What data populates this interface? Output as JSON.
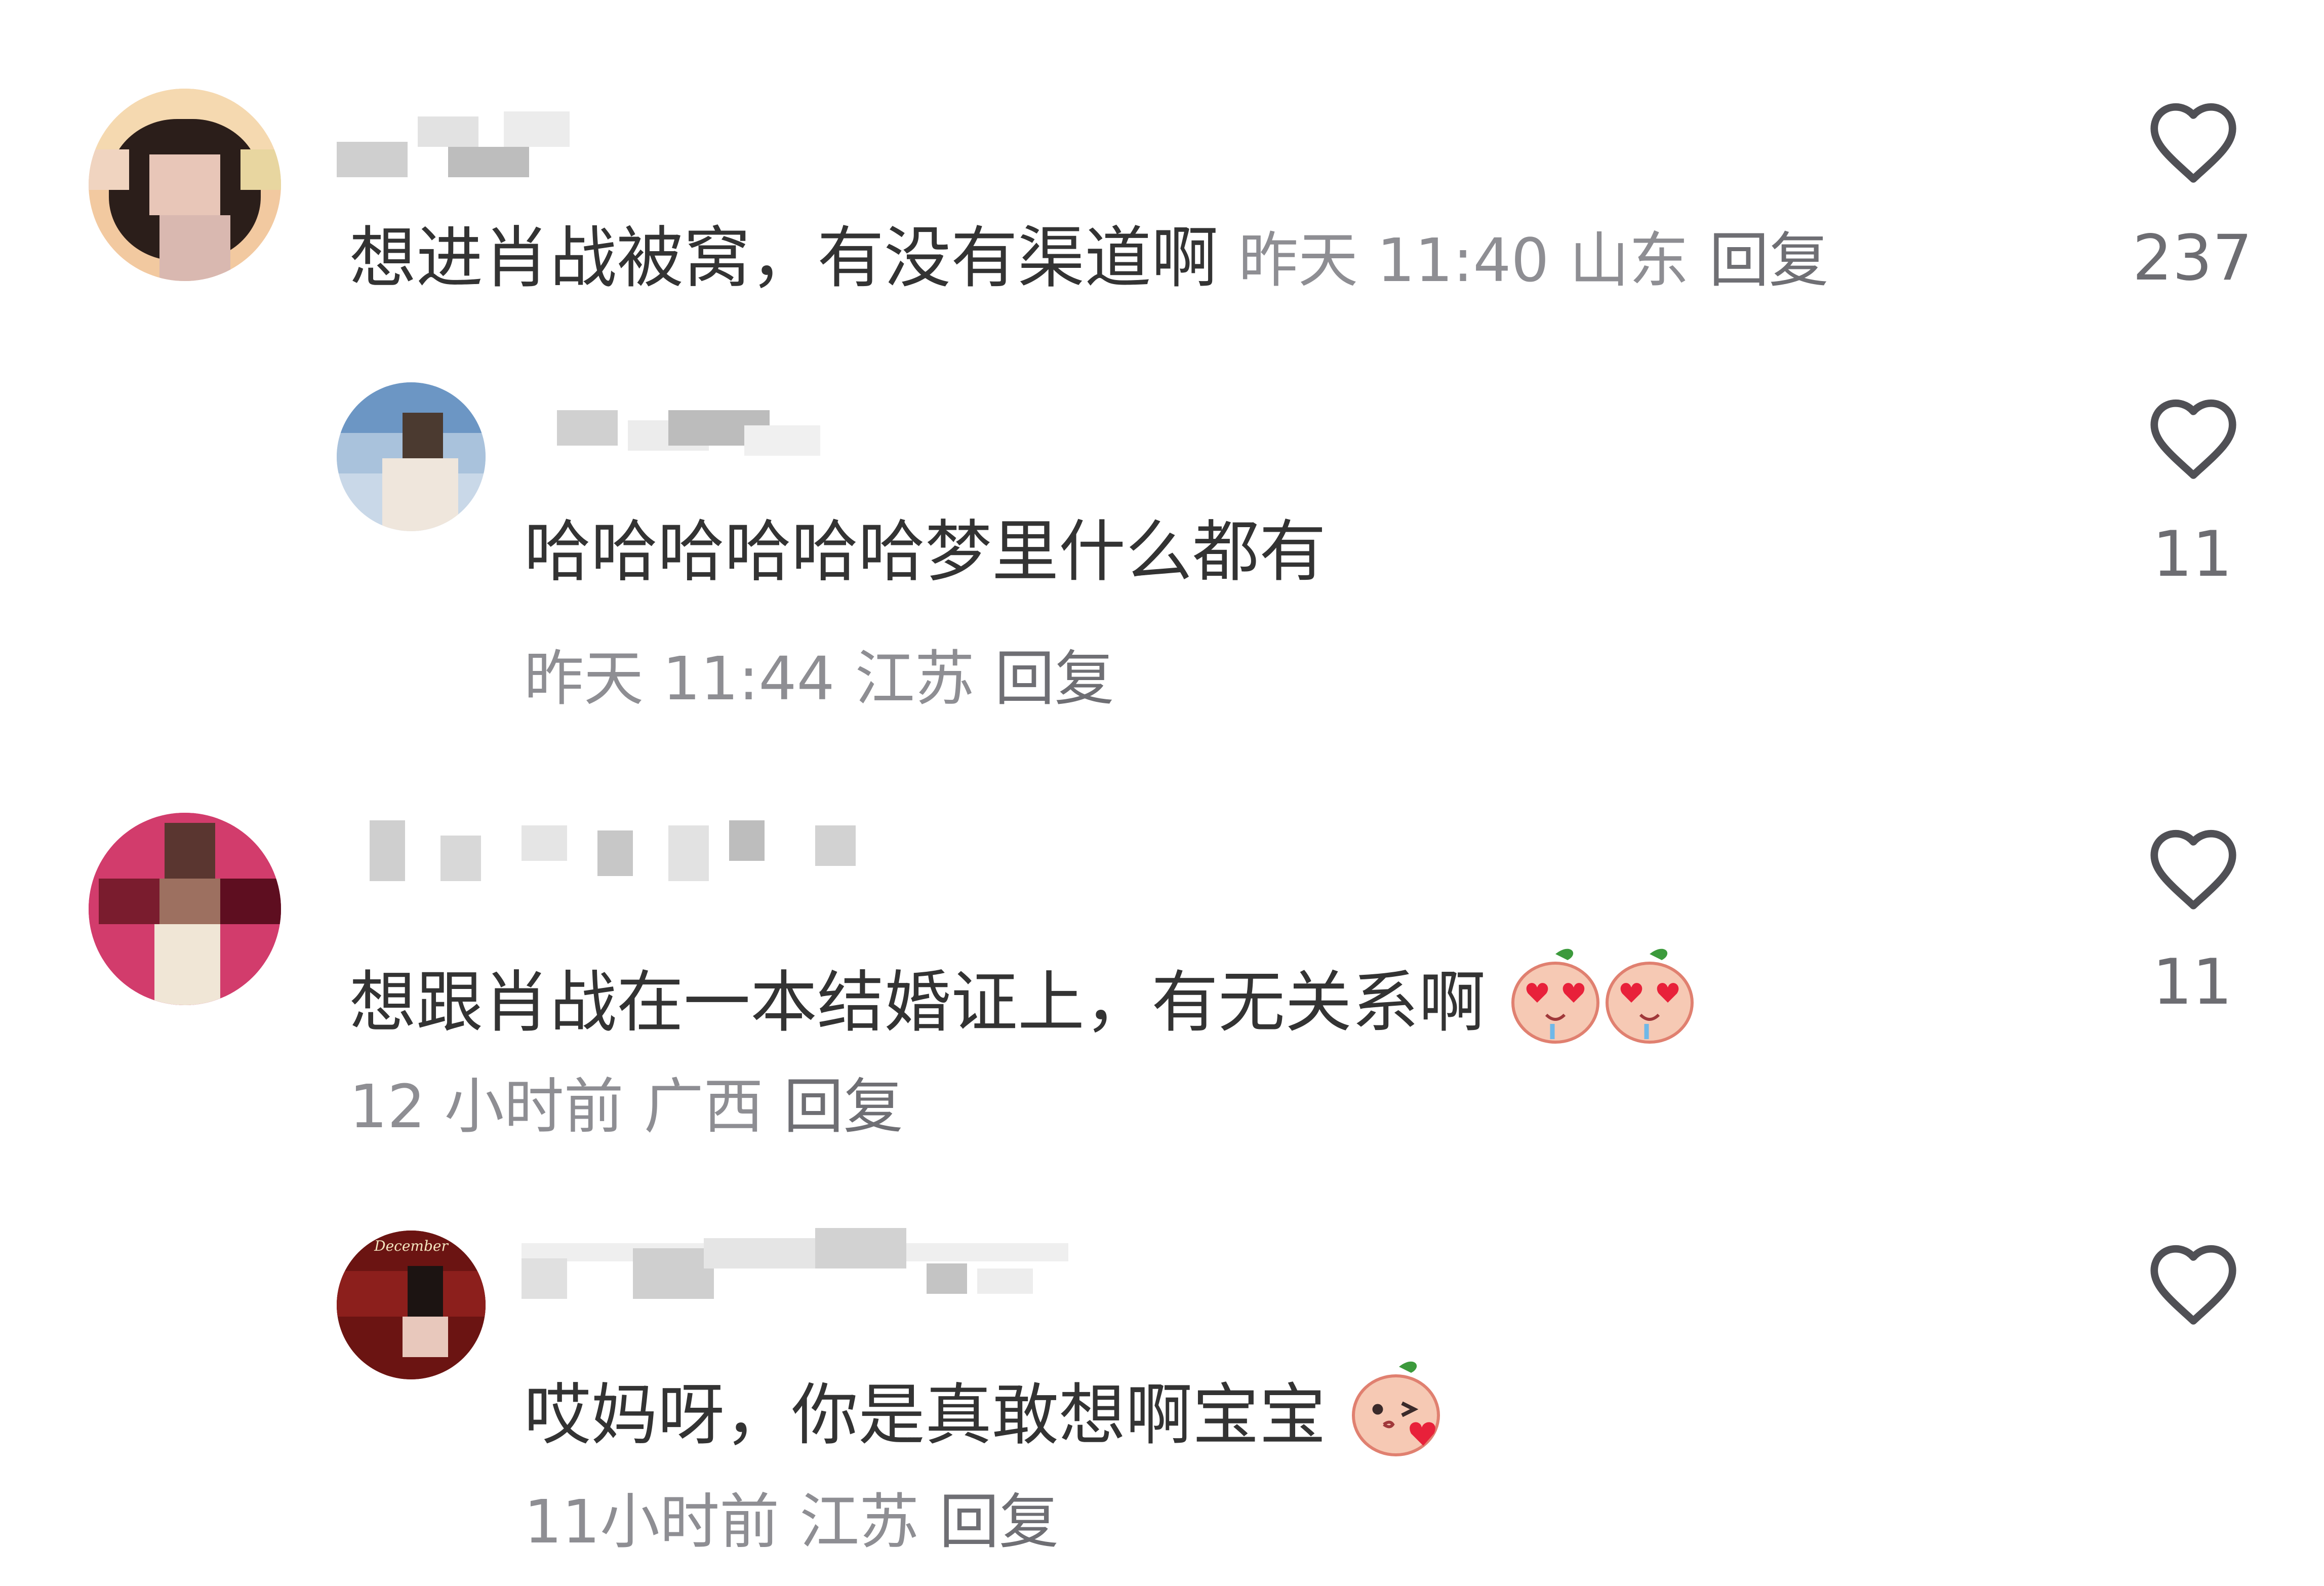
{
  "comments": [
    {
      "text": "想进肖战被窝，有没有渠道啊",
      "time": "昨天 11:40",
      "location": "山东",
      "reply_label": "回复",
      "likes": "237"
    },
    {
      "text": "哈哈哈哈哈哈梦里什么都有",
      "time": "昨天 11:44",
      "location": "江苏",
      "reply_label": "回复",
      "likes": "11"
    },
    {
      "text": "想跟肖战在一本结婚证上，有无关系啊",
      "time": "12 小时前",
      "location": "广西",
      "reply_label": "回复",
      "likes": "11",
      "emojis": [
        "heart-eyes-emoji",
        "heart-eyes-emoji"
      ]
    },
    {
      "text": "哎妈呀，你是真敢想啊宝宝",
      "time": "11小时前",
      "location": "江苏",
      "reply_label": "回复",
      "emojis": [
        "kiss-emoji"
      ]
    }
  ],
  "avatar_text": "December",
  "colors": {
    "text": "#333333",
    "meta": "#8e8e93",
    "heart_outline": "#505055"
  }
}
